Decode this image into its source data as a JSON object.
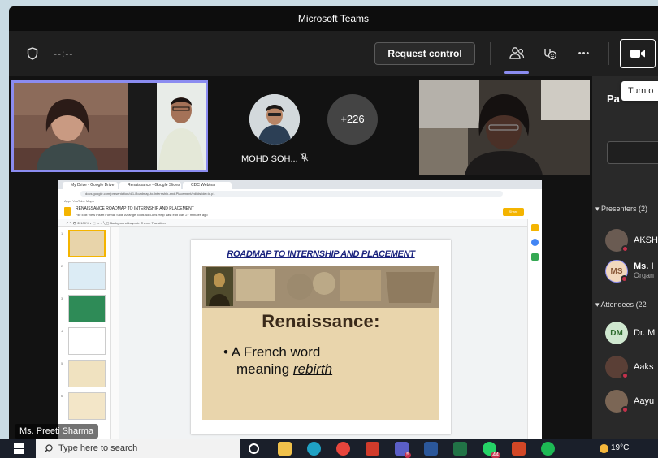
{
  "window": {
    "title": "Microsoft Teams"
  },
  "toolbar": {
    "timer": "--:--",
    "request_control_label": "Request control",
    "more_label": "•••",
    "tooltip": "Turn o"
  },
  "stage": {
    "avatar_name": "MOHD SOH...",
    "overflow_count": "+226",
    "presenter_name": "Ms. Preeti Sharma"
  },
  "shared_screen": {
    "browser_tabs": [
      "My Drive - Google Drive",
      "Renaissance - Google Slides",
      "CDC Webinar"
    ],
    "address": "docs.google.com/presentation/d/1-Roadmap-to-Internship-and-Placement/edit#slide=id.p1",
    "bookmarks": "Apps  YouTube  Maps",
    "doc_title": "RENAISSANCE   ROADMAP TO INTERNSHIP AND PLACEMENT",
    "doc_menu": "File  Edit  View  Insert  Format  Slide  Arrange  Tools  Add-ons  Help   Last edit was 27 minutes ago",
    "share_label": "Share",
    "format_bar": "↶ ↷ 🖶  ⊕ 100%  ▾  ⬚  ▭  ○  ╲  ▢  Background   Layout▾   Theme   Transition",
    "slide": {
      "title": "ROADMAP TO INTERNSHIP AND PLACEMENT",
      "heading": "Renaissance:",
      "bullet_line1": "A French word",
      "bullet_line2_prefix": "meaning ",
      "bullet_line2_em": "rebirth"
    }
  },
  "participants": {
    "title": "Pa",
    "presenters_label": "Presenters (2)",
    "attendees_label": "Attendees (22",
    "presenters": [
      {
        "initials": "",
        "name": "AKSH",
        "sub": ""
      },
      {
        "initials": "MS",
        "name": "Ms. I",
        "sub": "Organ"
      }
    ],
    "attendees": [
      {
        "initials": "DM",
        "name": "Dr. M"
      },
      {
        "initials": "",
        "name": "Aaks"
      },
      {
        "initials": "",
        "name": "Aayu"
      }
    ]
  },
  "taskbar": {
    "search_placeholder": "Type here to search",
    "temperature": "19°C",
    "teams_badge": "5",
    "whatsapp_badge": "44"
  },
  "colors": {
    "accent": "#8b8cf0",
    "presence_busy": "#c4314b",
    "slide_title": "#1a237e"
  }
}
